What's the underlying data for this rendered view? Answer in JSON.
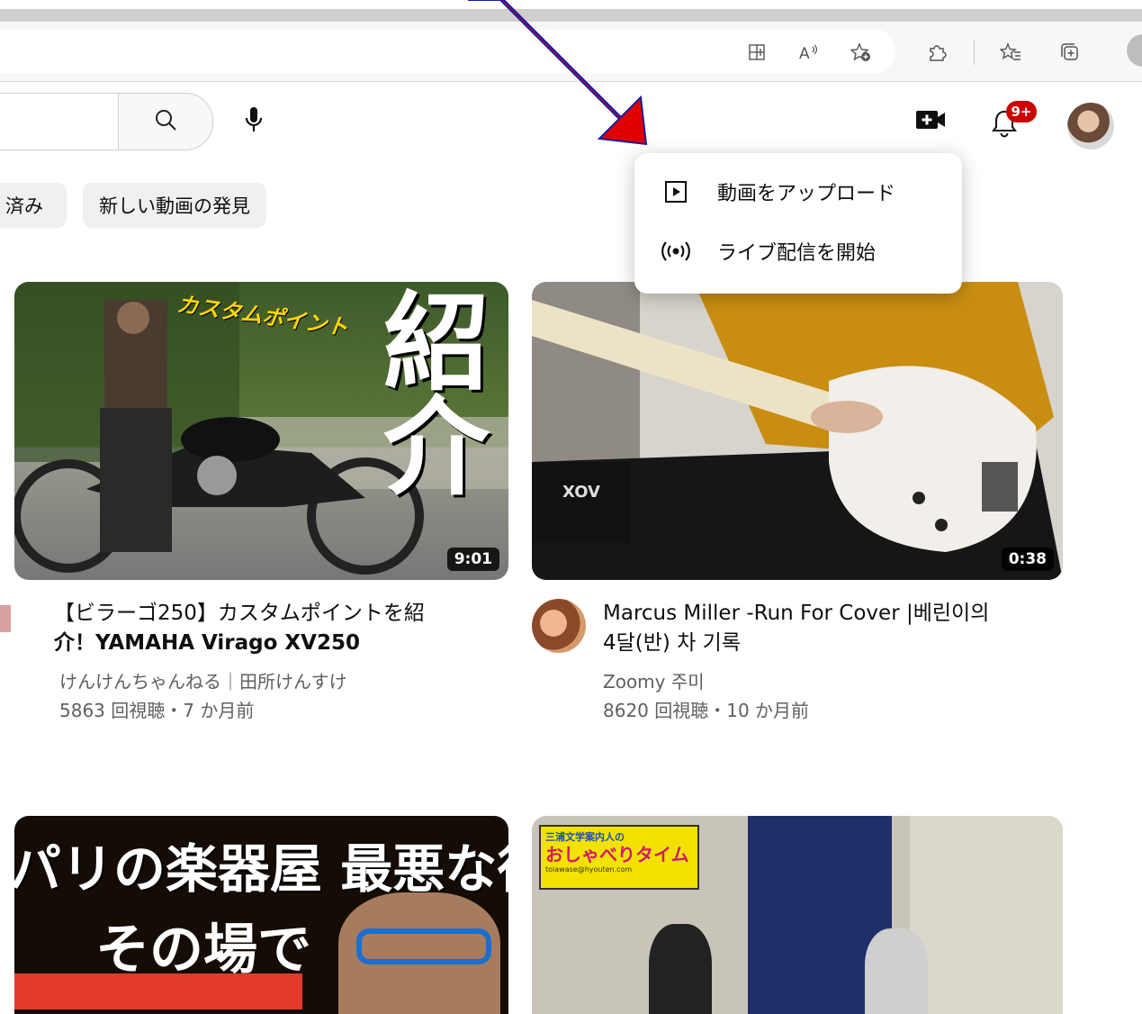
{
  "browser": {
    "toolbar_icons": [
      "split-screen-icon",
      "read-aloud-icon",
      "add-favorite-icon",
      "extensions-icon",
      "favorites-icon",
      "collections-icon"
    ]
  },
  "header": {
    "notification_badge": "9+",
    "icons": [
      "search-icon",
      "microphone-icon",
      "create-video-icon",
      "bell-icon"
    ]
  },
  "chips": [
    {
      "label": "済み"
    },
    {
      "label": "新しい動画の発見"
    }
  ],
  "create_menu": {
    "items": [
      {
        "label": "動画をアップロード",
        "icon": "play-square-icon"
      },
      {
        "label": "ライブ配信を開始",
        "icon": "broadcast-icon"
      }
    ]
  },
  "videos": [
    {
      "title_line1": "【ビラーゴ250】カスタムポイントを紹",
      "title_line2": "介！YAMAHA Virago XV250",
      "channel": "けんけんちゃんねる｜田所けんすけ",
      "stats": "5863 回視聴・7 か月前",
      "duration": "9:01",
      "thumb_text": "紹介",
      "thumb_caption": "カスタムポイント"
    },
    {
      "title_line1": "Marcus Miller -Run For Cover |베린이의",
      "title_line2": "4달(반) 차 기록",
      "channel": "Zoomy 주미",
      "stats": "8620 回視聴・10 か月前",
      "duration": "0:38",
      "amp_label": "XOV"
    },
    {
      "thumb_text_top": "パリの楽器屋 最悪な待遇",
      "thumb_text_mid": "その場で"
    },
    {
      "thumb_caption_line1": "三浦文学案内人の",
      "thumb_caption_line2": "おしゃべりタイム",
      "thumb_caption_line3": "toiawase@hyouten.com"
    }
  ],
  "colors": {
    "accent_red": "#e00000",
    "badge_red": "#cc0000",
    "chip_bg": "#f0f0f0",
    "meta_text": "#606060"
  }
}
